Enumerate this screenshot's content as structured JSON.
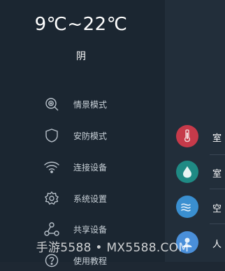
{
  "weather": {
    "temperature_range": "9℃~22℃",
    "condition": "阴"
  },
  "menu": [
    {
      "label": "情景模式",
      "icon": "scene-icon"
    },
    {
      "label": "安防模式",
      "icon": "shield-icon"
    },
    {
      "label": "连接设备",
      "icon": "wifi-icon"
    },
    {
      "label": "系统设置",
      "icon": "gear-icon"
    },
    {
      "label": "共享设备",
      "icon": "share-icon"
    },
    {
      "label": "使用教程",
      "icon": "help-icon"
    }
  ],
  "devices": [
    {
      "label": "室",
      "icon": "thermometer-icon",
      "color": "#c63a4a"
    },
    {
      "label": "室",
      "icon": "humidity-icon",
      "color": "#1f8a84"
    },
    {
      "label": "空",
      "icon": "air-icon",
      "color": "#3a8fd0"
    },
    {
      "label": "人",
      "icon": "person-icon",
      "color": "#4a8fd9"
    }
  ],
  "watermark": "手游5588 • MX5588.COM",
  "colors": {
    "sidebar_bg": "#1b2631",
    "panel_bg": "#222e3a",
    "text": "#c9d1d8"
  }
}
